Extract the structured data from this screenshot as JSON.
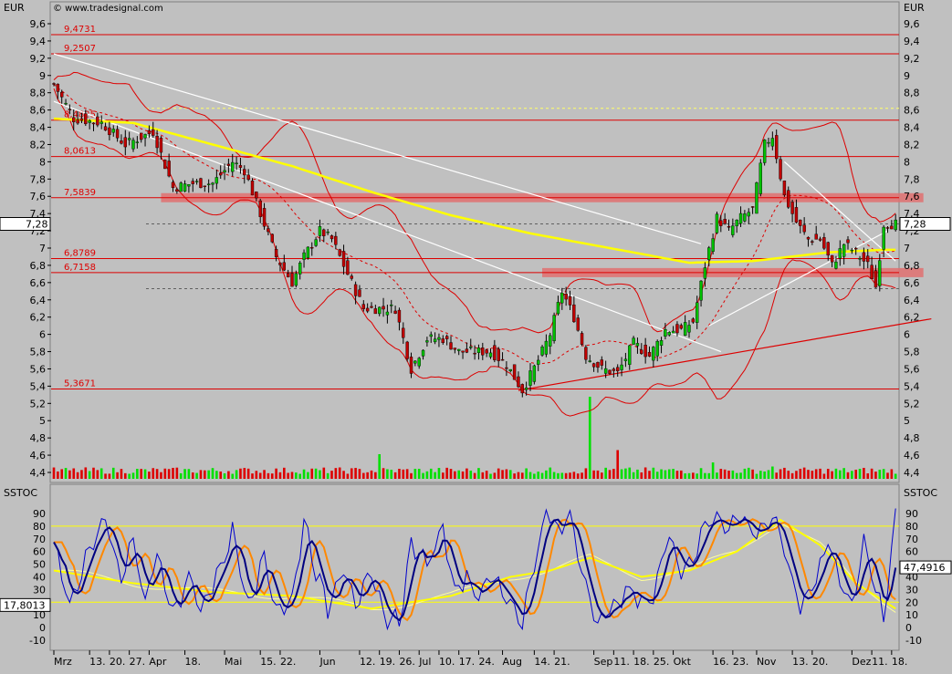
{
  "header": {
    "currency_left": "EUR",
    "currency_right": "EUR",
    "watermark": "© www.tradesignal.com",
    "indicator_left": "SSTOC",
    "indicator_right": "SSTOC"
  },
  "colors": {
    "background": "#c0c0c0",
    "up_candle": "#00c000",
    "down_candle": "#c00000",
    "level_line": "#dd0000",
    "sma_long": "#ffff00",
    "stoch_fast": "#000080",
    "stoch_slow": "#ff8800"
  },
  "chart_data": [
    {
      "type": "candlestick",
      "title": "",
      "ylim": [
        4.3,
        9.7
      ],
      "yticks": [
        "9,6",
        "9,4",
        "9,2",
        "9",
        "8,8",
        "8,6",
        "8,4",
        "8,2",
        "8",
        "7,8",
        "7,6",
        "7,4",
        "7,2",
        "7",
        "6,8",
        "6,6",
        "6,4",
        "6,2",
        "6",
        "5,8",
        "5,6",
        "5,4",
        "5,2",
        "5",
        "4,8",
        "4,6",
        "4,4"
      ],
      "last_price": "7,28",
      "level_labels": [
        "9,4731",
        "9,2507",
        "8,4825",
        "8,0613",
        "7,5839",
        "6,8789",
        "6,7158",
        "5,3671"
      ],
      "levels": [
        9.4731,
        9.2507,
        8.4825,
        8.0613,
        7.5839,
        6.8789,
        6.7158,
        5.3671
      ],
      "highlight_bands": [
        {
          "from_index": 27,
          "to_index": 219,
          "level": 7.5839
        },
        {
          "from_index": 123,
          "to_index": 219,
          "level": 6.7158
        }
      ],
      "dotted_levels": [
        8.62,
        7.28,
        6.53
      ],
      "anchors": [
        {
          "i": 0,
          "p": 8.9
        },
        {
          "i": 5,
          "p": 8.5
        },
        {
          "i": 12,
          "p": 8.45
        },
        {
          "i": 18,
          "p": 8.2
        },
        {
          "i": 25,
          "p": 8.35
        },
        {
          "i": 30,
          "p": 7.7
        },
        {
          "i": 35,
          "p": 7.75
        },
        {
          "i": 40,
          "p": 7.75
        },
        {
          "i": 45,
          "p": 8.0
        },
        {
          "i": 48,
          "p": 7.9
        },
        {
          "i": 52,
          "p": 7.4
        },
        {
          "i": 56,
          "p": 6.9
        },
        {
          "i": 60,
          "p": 6.6
        },
        {
          "i": 63,
          "p": 6.9
        },
        {
          "i": 67,
          "p": 7.2
        },
        {
          "i": 70,
          "p": 7.1
        },
        {
          "i": 74,
          "p": 6.7
        },
        {
          "i": 78,
          "p": 6.3
        },
        {
          "i": 82,
          "p": 6.3
        },
        {
          "i": 86,
          "p": 6.3
        },
        {
          "i": 90,
          "p": 5.6
        },
        {
          "i": 94,
          "p": 5.95
        },
        {
          "i": 98,
          "p": 5.95
        },
        {
          "i": 102,
          "p": 5.8
        },
        {
          "i": 106,
          "p": 5.8
        },
        {
          "i": 110,
          "p": 5.8
        },
        {
          "i": 114,
          "p": 5.65
        },
        {
          "i": 118,
          "p": 5.35
        },
        {
          "i": 122,
          "p": 5.7
        },
        {
          "i": 125,
          "p": 6.0
        },
        {
          "i": 128,
          "p": 6.5
        },
        {
          "i": 131,
          "p": 6.2
        },
        {
          "i": 134,
          "p": 5.75
        },
        {
          "i": 138,
          "p": 5.6
        },
        {
          "i": 142,
          "p": 5.55
        },
        {
          "i": 146,
          "p": 5.9
        },
        {
          "i": 150,
          "p": 5.75
        },
        {
          "i": 154,
          "p": 6.05
        },
        {
          "i": 158,
          "p": 6.05
        },
        {
          "i": 161,
          "p": 6.15
        },
        {
          "i": 164,
          "p": 6.8
        },
        {
          "i": 167,
          "p": 7.35
        },
        {
          "i": 170,
          "p": 7.2
        },
        {
          "i": 173,
          "p": 7.35
        },
        {
          "i": 176,
          "p": 7.45
        },
        {
          "i": 179,
          "p": 8.2
        },
        {
          "i": 181,
          "p": 8.3
        },
        {
          "i": 184,
          "p": 7.6
        },
        {
          "i": 187,
          "p": 7.3
        },
        {
          "i": 190,
          "p": 7.1
        },
        {
          "i": 193,
          "p": 7.1
        },
        {
          "i": 196,
          "p": 6.8
        },
        {
          "i": 199,
          "p": 7.05
        },
        {
          "i": 202,
          "p": 6.95
        },
        {
          "i": 205,
          "p": 6.8
        },
        {
          "i": 207,
          "p": 6.55
        },
        {
          "i": 209,
          "p": 7.28
        }
      ],
      "volume_spikes": [
        {
          "i": 82,
          "v": 3.0
        },
        {
          "i": 135,
          "v": 10.0
        },
        {
          "i": 142,
          "v": 3.5
        },
        {
          "i": 166,
          "v": 2.0
        },
        {
          "i": 181,
          "v": 1.5
        }
      ],
      "sma200": [
        {
          "i": 0,
          "p": 8.5
        },
        {
          "i": 20,
          "p": 8.45
        },
        {
          "i": 40,
          "p": 8.2
        },
        {
          "i": 60,
          "p": 7.95
        },
        {
          "i": 80,
          "p": 7.65
        },
        {
          "i": 100,
          "p": 7.38
        },
        {
          "i": 120,
          "p": 7.17
        },
        {
          "i": 140,
          "p": 7.0
        },
        {
          "i": 160,
          "p": 6.83
        },
        {
          "i": 176,
          "p": 6.85
        },
        {
          "i": 195,
          "p": 6.95
        },
        {
          "i": 209,
          "p": 6.98
        }
      ],
      "trendlines": [
        {
          "from": {
            "i": 0,
            "p": 9.25
          },
          "to": {
            "i": 163,
            "p": 7.05
          },
          "color": "#ffffff"
        },
        {
          "from": {
            "i": 0,
            "p": 8.7
          },
          "to": {
            "i": 168,
            "p": 5.8
          },
          "color": "#ffffff"
        },
        {
          "from": {
            "i": 117,
            "p": 5.35
          },
          "to": {
            "i": 221,
            "p": 6.18
          },
          "color": "#dd0000"
        },
        {
          "from": {
            "i": 184,
            "p": 8.0
          },
          "to": {
            "i": 212,
            "p": 6.85
          },
          "color": "#ffffff"
        },
        {
          "from": {
            "i": 165,
            "p": 6.1
          },
          "to": {
            "i": 210,
            "p": 7.2
          },
          "color": "#ffffff"
        }
      ],
      "x_tick_labels": [
        {
          "i": 0,
          "label": "Mrz"
        },
        {
          "i": 9,
          "label": "13."
        },
        {
          "i": 14,
          "label": "20."
        },
        {
          "i": 19,
          "label": "27."
        },
        {
          "i": 24,
          "label": "Apr"
        },
        {
          "i": 33,
          "label": "18."
        },
        {
          "i": 43,
          "label": "Mai"
        },
        {
          "i": 52,
          "label": "15."
        },
        {
          "i": 57,
          "label": "22."
        },
        {
          "i": 67,
          "label": "Jun"
        },
        {
          "i": 77,
          "label": "12."
        },
        {
          "i": 82,
          "label": "19."
        },
        {
          "i": 87,
          "label": "26."
        },
        {
          "i": 92,
          "label": "Jul"
        },
        {
          "i": 97,
          "label": "10."
        },
        {
          "i": 102,
          "label": "17."
        },
        {
          "i": 107,
          "label": "24."
        },
        {
          "i": 113,
          "label": "Aug"
        },
        {
          "i": 121,
          "label": "14."
        },
        {
          "i": 126,
          "label": "21."
        },
        {
          "i": 136,
          "label": "Sep"
        },
        {
          "i": 141,
          "label": "11."
        },
        {
          "i": 146,
          "label": "18."
        },
        {
          "i": 151,
          "label": "25."
        },
        {
          "i": 156,
          "label": "Okt"
        },
        {
          "i": 166,
          "label": "16."
        },
        {
          "i": 171,
          "label": "23."
        },
        {
          "i": 177,
          "label": "Nov"
        },
        {
          "i": 186,
          "label": "13."
        },
        {
          "i": 191,
          "label": "20."
        },
        {
          "i": 201,
          "label": "Dez"
        },
        {
          "i": 206,
          "label": "11."
        },
        {
          "i": 211,
          "label": "18."
        }
      ]
    },
    {
      "type": "line",
      "title": "SSTOC",
      "ylim": [
        -15,
        100
      ],
      "yticks": [
        "90",
        "80",
        "70",
        "60",
        "50",
        "40",
        "30",
        "20",
        "10",
        "0",
        "-10"
      ],
      "hlines": [
        80,
        20
      ],
      "last_values": {
        "upper": "47,4916",
        "lower": "17,8013"
      },
      "stoch_anchors": [
        {
          "i": 0,
          "v": 65
        },
        {
          "i": 4,
          "v": 20
        },
        {
          "i": 9,
          "v": 60
        },
        {
          "i": 13,
          "v": 85
        },
        {
          "i": 17,
          "v": 35
        },
        {
          "i": 20,
          "v": 70
        },
        {
          "i": 23,
          "v": 20
        },
        {
          "i": 26,
          "v": 60
        },
        {
          "i": 30,
          "v": 10
        },
        {
          "i": 34,
          "v": 40
        },
        {
          "i": 37,
          "v": 15
        },
        {
          "i": 41,
          "v": 40
        },
        {
          "i": 45,
          "v": 75
        },
        {
          "i": 49,
          "v": 20
        },
        {
          "i": 53,
          "v": 55
        },
        {
          "i": 56,
          "v": 15
        },
        {
          "i": 60,
          "v": 20
        },
        {
          "i": 63,
          "v": 85
        },
        {
          "i": 66,
          "v": 45
        },
        {
          "i": 69,
          "v": 15
        },
        {
          "i": 73,
          "v": 50
        },
        {
          "i": 76,
          "v": 20
        },
        {
          "i": 80,
          "v": 40
        },
        {
          "i": 83,
          "v": 10
        },
        {
          "i": 87,
          "v": 5
        },
        {
          "i": 90,
          "v": 65
        },
        {
          "i": 94,
          "v": 50
        },
        {
          "i": 98,
          "v": 80
        },
        {
          "i": 101,
          "v": 30
        },
        {
          "i": 104,
          "v": 40
        },
        {
          "i": 107,
          "v": 25
        },
        {
          "i": 110,
          "v": 40
        },
        {
          "i": 114,
          "v": 25
        },
        {
          "i": 118,
          "v": 5
        },
        {
          "i": 121,
          "v": 50
        },
        {
          "i": 124,
          "v": 92
        },
        {
          "i": 127,
          "v": 75
        },
        {
          "i": 130,
          "v": 88
        },
        {
          "i": 133,
          "v": 45
        },
        {
          "i": 137,
          "v": 5
        },
        {
          "i": 141,
          "v": 15
        },
        {
          "i": 144,
          "v": 30
        },
        {
          "i": 148,
          "v": 20
        },
        {
          "i": 151,
          "v": 25
        },
        {
          "i": 155,
          "v": 75
        },
        {
          "i": 158,
          "v": 45
        },
        {
          "i": 161,
          "v": 55
        },
        {
          "i": 164,
          "v": 80
        },
        {
          "i": 167,
          "v": 88
        },
        {
          "i": 170,
          "v": 80
        },
        {
          "i": 173,
          "v": 88
        },
        {
          "i": 176,
          "v": 75
        },
        {
          "i": 179,
          "v": 80
        },
        {
          "i": 181,
          "v": 88
        },
        {
          "i": 184,
          "v": 60
        },
        {
          "i": 188,
          "v": 15
        },
        {
          "i": 192,
          "v": 40
        },
        {
          "i": 195,
          "v": 70
        },
        {
          "i": 198,
          "v": 35
        },
        {
          "i": 201,
          "v": 20
        },
        {
          "i": 204,
          "v": 65
        },
        {
          "i": 207,
          "v": 30
        },
        {
          "i": 209,
          "v": 5
        },
        {
          "i": 212,
          "v": 90
        }
      ],
      "signal_anchors": [
        {
          "i": 0,
          "v": 45
        },
        {
          "i": 20,
          "v": 35
        },
        {
          "i": 40,
          "v": 28
        },
        {
          "i": 60,
          "v": 25
        },
        {
          "i": 80,
          "v": 15
        },
        {
          "i": 100,
          "v": 25
        },
        {
          "i": 115,
          "v": 40
        },
        {
          "i": 125,
          "v": 45
        },
        {
          "i": 135,
          "v": 55
        },
        {
          "i": 148,
          "v": 40
        },
        {
          "i": 160,
          "v": 45
        },
        {
          "i": 172,
          "v": 60
        },
        {
          "i": 183,
          "v": 85
        },
        {
          "i": 193,
          "v": 65
        },
        {
          "i": 202,
          "v": 35
        },
        {
          "i": 212,
          "v": 15
        }
      ]
    }
  ]
}
